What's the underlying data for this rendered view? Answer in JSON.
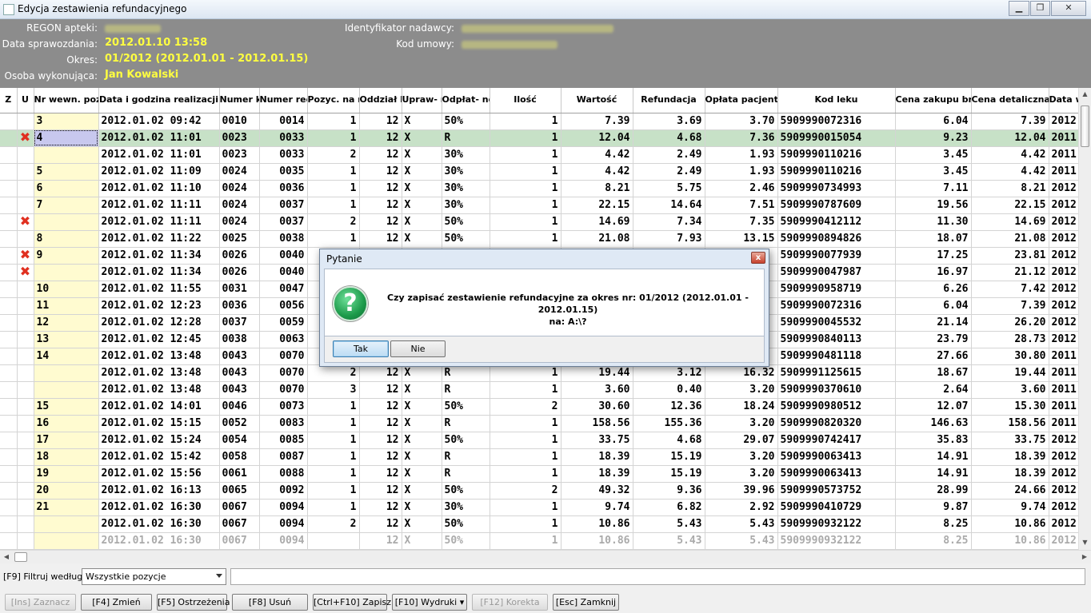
{
  "window": {
    "title": "Edycja zestawienia refundacyjnego",
    "minimize_label": "▁",
    "restore_label": "❐",
    "close_label": "✕"
  },
  "header": {
    "regon_label": "REGON apteki:",
    "data_label": "Data sprawozdania:",
    "data_value": "2012.01.10 13:58",
    "okres_label": "Okres:",
    "okres_value": "01/2012 (2012.01.01 - 2012.01.15)",
    "osoba_label": "Osoba wykonująca:",
    "osoba_value": "Jan Kowalski",
    "ident_label": "Identyfikator nadawcy:",
    "kod_label": "Kod umowy:"
  },
  "table": {
    "columns": [
      "Z",
      "U",
      "Nr wewn. pozycji",
      "Data i godzina realizacji",
      "Numer klienta",
      "Numer recepty",
      "Pozyc. na rec.",
      "Oddział NFZ",
      "Upraw- nienie",
      "Odpłat- ność",
      "Ilość",
      "Wartość",
      "Refundacja",
      "Opłata pacjenta",
      "Kod leku",
      "Cena zakupu brutto",
      "Cena detaliczna brutto",
      "Data w"
    ],
    "rows": [
      {
        "x": "",
        "nr": "3",
        "dt": "2012.01.02 09:42",
        "kl": "0010",
        "rec": "0014",
        "poz": "1",
        "odd": "12",
        "upr": "X",
        "odp": "50%",
        "il": "1",
        "war": "7.39",
        "ref": "3.69",
        "opl": "3.70",
        "kod": "5909990072316",
        "cz": "6.04",
        "cd": "7.39",
        "dw": "2012"
      },
      {
        "x": "✖",
        "nr": "4",
        "dt": "2012.01.02 11:01",
        "kl": "0023",
        "rec": "0033",
        "poz": "1",
        "odd": "12",
        "upr": "X",
        "odp": "R",
        "il": "1",
        "war": "12.04",
        "ref": "4.68",
        "opl": "7.36",
        "kod": "5909990015054",
        "cz": "9.23",
        "cd": "12.04",
        "dw": "2011"
      },
      {
        "x": "",
        "nr": "",
        "dt": "2012.01.02 11:01",
        "kl": "0023",
        "rec": "0033",
        "poz": "2",
        "odd": "12",
        "upr": "X",
        "odp": "30%",
        "il": "1",
        "war": "4.42",
        "ref": "2.49",
        "opl": "1.93",
        "kod": "5909990110216",
        "cz": "3.45",
        "cd": "4.42",
        "dw": "2011"
      },
      {
        "x": "",
        "nr": "5",
        "dt": "2012.01.02 11:09",
        "kl": "0024",
        "rec": "0035",
        "poz": "1",
        "odd": "12",
        "upr": "X",
        "odp": "30%",
        "il": "1",
        "war": "4.42",
        "ref": "2.49",
        "opl": "1.93",
        "kod": "5909990110216",
        "cz": "3.45",
        "cd": "4.42",
        "dw": "2011"
      },
      {
        "x": "",
        "nr": "6",
        "dt": "2012.01.02 11:10",
        "kl": "0024",
        "rec": "0036",
        "poz": "1",
        "odd": "12",
        "upr": "X",
        "odp": "30%",
        "il": "1",
        "war": "8.21",
        "ref": "5.75",
        "opl": "2.46",
        "kod": "5909990734993",
        "cz": "7.11",
        "cd": "8.21",
        "dw": "2012"
      },
      {
        "x": "",
        "nr": "7",
        "dt": "2012.01.02 11:11",
        "kl": "0024",
        "rec": "0037",
        "poz": "1",
        "odd": "12",
        "upr": "X",
        "odp": "30%",
        "il": "1",
        "war": "22.15",
        "ref": "14.64",
        "opl": "7.51",
        "kod": "5909990787609",
        "cz": "19.56",
        "cd": "22.15",
        "dw": "2012"
      },
      {
        "x": "✖",
        "nr": "",
        "dt": "2012.01.02 11:11",
        "kl": "0024",
        "rec": "0037",
        "poz": "2",
        "odd": "12",
        "upr": "X",
        "odp": "50%",
        "il": "1",
        "war": "14.69",
        "ref": "7.34",
        "opl": "7.35",
        "kod": "5909990412112",
        "cz": "11.30",
        "cd": "14.69",
        "dw": "2012"
      },
      {
        "x": "",
        "nr": "8",
        "dt": "2012.01.02 11:22",
        "kl": "0025",
        "rec": "0038",
        "poz": "1",
        "odd": "12",
        "upr": "X",
        "odp": "50%",
        "il": "1",
        "war": "21.08",
        "ref": "7.93",
        "opl": "13.15",
        "kod": "5909990894826",
        "cz": "18.07",
        "cd": "21.08",
        "dw": "2012"
      },
      {
        "x": "✖",
        "nr": "9",
        "dt": "2012.01.02 11:34",
        "kl": "0026",
        "rec": "0040",
        "poz": "",
        "odd": "",
        "upr": "",
        "odp": "",
        "il": "",
        "war": "",
        "ref": "",
        "opl": "",
        "kod": "5909990077939",
        "cz": "17.25",
        "cd": "23.81",
        "dw": "2012"
      },
      {
        "x": "✖",
        "nr": "",
        "dt": "2012.01.02 11:34",
        "kl": "0026",
        "rec": "0040",
        "poz": "",
        "odd": "",
        "upr": "",
        "odp": "",
        "il": "",
        "war": "",
        "ref": "",
        "opl": "",
        "kod": "5909990047987",
        "cz": "16.97",
        "cd": "21.12",
        "dw": "2012"
      },
      {
        "x": "",
        "nr": "10",
        "dt": "2012.01.02 11:55",
        "kl": "0031",
        "rec": "0047",
        "poz": "",
        "odd": "",
        "upr": "",
        "odp": "",
        "il": "",
        "war": "",
        "ref": "",
        "opl": "",
        "kod": "5909990958719",
        "cz": "6.26",
        "cd": "7.42",
        "dw": "2012"
      },
      {
        "x": "",
        "nr": "11",
        "dt": "2012.01.02 12:23",
        "kl": "0036",
        "rec": "0056",
        "poz": "",
        "odd": "",
        "upr": "",
        "odp": "",
        "il": "",
        "war": "",
        "ref": "",
        "opl": "",
        "kod": "5909990072316",
        "cz": "6.04",
        "cd": "7.39",
        "dw": "2012"
      },
      {
        "x": "",
        "nr": "12",
        "dt": "2012.01.02 12:28",
        "kl": "0037",
        "rec": "0059",
        "poz": "",
        "odd": "",
        "upr": "",
        "odp": "",
        "il": "",
        "war": "",
        "ref": "",
        "opl": "",
        "kod": "5909990045532",
        "cz": "21.14",
        "cd": "26.20",
        "dw": "2012"
      },
      {
        "x": "",
        "nr": "13",
        "dt": "2012.01.02 12:45",
        "kl": "0038",
        "rec": "0063",
        "poz": "",
        "odd": "",
        "upr": "",
        "odp": "",
        "il": "",
        "war": "",
        "ref": "",
        "opl": "",
        "kod": "5909990840113",
        "cz": "23.79",
        "cd": "28.73",
        "dw": "2012"
      },
      {
        "x": "",
        "nr": "14",
        "dt": "2012.01.02 13:48",
        "kl": "0043",
        "rec": "0070",
        "poz": "",
        "odd": "",
        "upr": "",
        "odp": "",
        "il": "",
        "war": "",
        "ref": "",
        "opl": "",
        "kod": "5909990481118",
        "cz": "27.66",
        "cd": "30.80",
        "dw": "2011"
      },
      {
        "x": "",
        "nr": "",
        "dt": "2012.01.02 13:48",
        "kl": "0043",
        "rec": "0070",
        "poz": "2",
        "odd": "12",
        "upr": "X",
        "odp": "R",
        "il": "1",
        "war": "19.44",
        "ref": "3.12",
        "opl": "16.32",
        "kod": "5909991125615",
        "cz": "18.67",
        "cd": "19.44",
        "dw": "2011"
      },
      {
        "x": "",
        "nr": "",
        "dt": "2012.01.02 13:48",
        "kl": "0043",
        "rec": "0070",
        "poz": "3",
        "odd": "12",
        "upr": "X",
        "odp": "R",
        "il": "1",
        "war": "3.60",
        "ref": "0.40",
        "opl": "3.20",
        "kod": "5909990370610",
        "cz": "2.64",
        "cd": "3.60",
        "dw": "2011"
      },
      {
        "x": "",
        "nr": "15",
        "dt": "2012.01.02 14:01",
        "kl": "0046",
        "rec": "0073",
        "poz": "1",
        "odd": "12",
        "upr": "X",
        "odp": "50%",
        "il": "2",
        "war": "30.60",
        "ref": "12.36",
        "opl": "18.24",
        "kod": "5909990980512",
        "cz": "12.07",
        "cd": "15.30",
        "dw": "2011"
      },
      {
        "x": "",
        "nr": "16",
        "dt": "2012.01.02 15:15",
        "kl": "0052",
        "rec": "0083",
        "poz": "1",
        "odd": "12",
        "upr": "X",
        "odp": "R",
        "il": "1",
        "war": "158.56",
        "ref": "155.36",
        "opl": "3.20",
        "kod": "5909990820320",
        "cz": "146.63",
        "cd": "158.56",
        "dw": "2011"
      },
      {
        "x": "",
        "nr": "17",
        "dt": "2012.01.02 15:24",
        "kl": "0054",
        "rec": "0085",
        "poz": "1",
        "odd": "12",
        "upr": "X",
        "odp": "50%",
        "il": "1",
        "war": "33.75",
        "ref": "4.68",
        "opl": "29.07",
        "kod": "5909990742417",
        "cz": "35.83",
        "cd": "33.75",
        "dw": "2012"
      },
      {
        "x": "",
        "nr": "18",
        "dt": "2012.01.02 15:42",
        "kl": "0058",
        "rec": "0087",
        "poz": "1",
        "odd": "12",
        "upr": "X",
        "odp": "R",
        "il": "1",
        "war": "18.39",
        "ref": "15.19",
        "opl": "3.20",
        "kod": "5909990063413",
        "cz": "14.91",
        "cd": "18.39",
        "dw": "2012"
      },
      {
        "x": "",
        "nr": "19",
        "dt": "2012.01.02 15:56",
        "kl": "0061",
        "rec": "0088",
        "poz": "1",
        "odd": "12",
        "upr": "X",
        "odp": "R",
        "il": "1",
        "war": "18.39",
        "ref": "15.19",
        "opl": "3.20",
        "kod": "5909990063413",
        "cz": "14.91",
        "cd": "18.39",
        "dw": "2012"
      },
      {
        "x": "",
        "nr": "20",
        "dt": "2012.01.02 16:13",
        "kl": "0065",
        "rec": "0092",
        "poz": "1",
        "odd": "12",
        "upr": "X",
        "odp": "50%",
        "il": "2",
        "war": "49.32",
        "ref": "9.36",
        "opl": "39.96",
        "kod": "5909990573752",
        "cz": "28.99",
        "cd": "24.66",
        "dw": "2012"
      },
      {
        "x": "",
        "nr": "21",
        "dt": "2012.01.02 16:30",
        "kl": "0067",
        "rec": "0094",
        "poz": "1",
        "odd": "12",
        "upr": "X",
        "odp": "30%",
        "il": "1",
        "war": "9.74",
        "ref": "6.82",
        "opl": "2.92",
        "kod": "5909990410729",
        "cz": "9.87",
        "cd": "9.74",
        "dw": "2012"
      },
      {
        "x": "",
        "nr": "",
        "dt": "2012.01.02 16:30",
        "kl": "0067",
        "rec": "0094",
        "poz": "2",
        "odd": "12",
        "upr": "X",
        "odp": "50%",
        "il": "1",
        "war": "10.86",
        "ref": "5.43",
        "opl": "5.43",
        "kod": "5909990932122",
        "cz": "8.25",
        "cd": "10.86",
        "dw": "2012"
      },
      {
        "x": "",
        "nr": "",
        "dt": "2012.01.02 16:30",
        "kl": "0067",
        "rec": "0094",
        "poz": "",
        "odd": "12",
        "upr": "X",
        "odp": "50%",
        "il": "1",
        "war": "10.86",
        "ref": "5.43",
        "opl": "5.43",
        "kod": "5909990932122",
        "cz": "8.25",
        "cd": "10.86",
        "dw": "2012"
      }
    ]
  },
  "filter": {
    "label": "[F9] Filtruj według:",
    "value": "Wszystkie pozycje"
  },
  "buttons": {
    "zaznacz": "[Ins] Zaznacz",
    "zmien": "[F4] Zmień",
    "ostrzezenia": "[F5] Ostrzeżenia",
    "usun": "[F8] Usuń",
    "zapisz": "[Ctrl+F10] Zapisz",
    "wydruki": "[F10] Wydruki ▾",
    "korekta": "[F12] Korekta",
    "zamknij": "[Esc] Zamknij"
  },
  "dialog": {
    "title": "Pytanie",
    "message_line1": "Czy zapisać zestawienie refundacyjne za okres nr: 01/2012 (2012.01.01 - 2012.01.15)",
    "message_line2": "na: A:\\?",
    "yes_label": "Tak",
    "no_label": "Nie",
    "close_label": "x",
    "icon_glyph": "?"
  },
  "colors": {
    "header_bg": "#8c8c8c",
    "header_value": "#ffff40",
    "selected_row": "#c7e1c7",
    "nr_column": "#fffbd0",
    "error_mark": "#e03020"
  }
}
